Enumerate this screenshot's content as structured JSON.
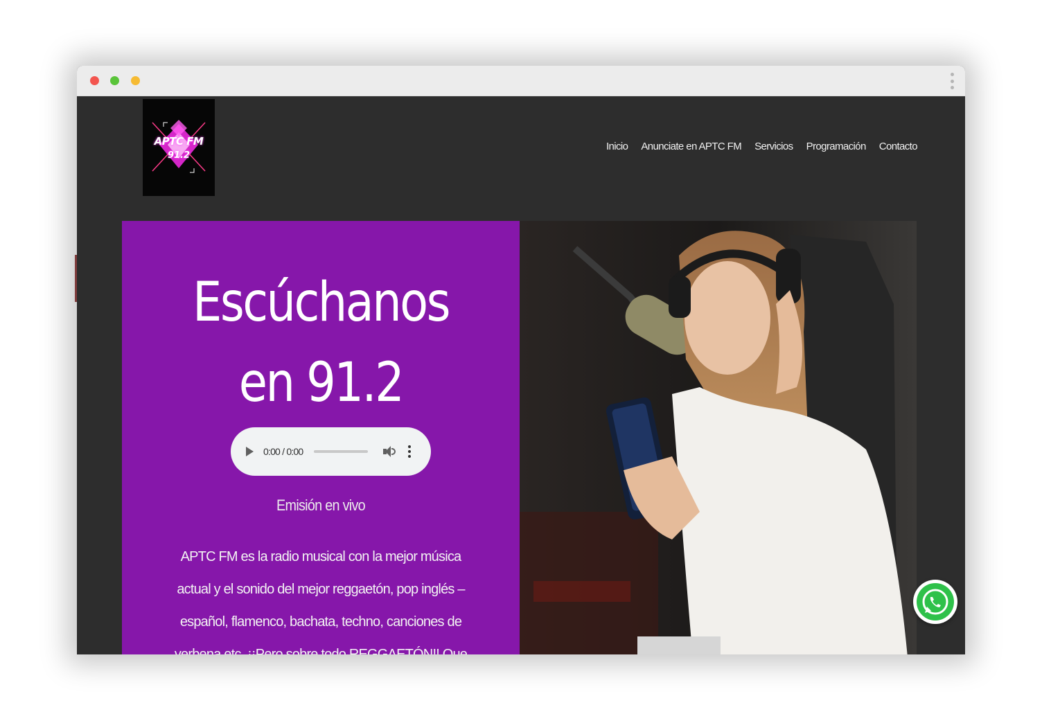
{
  "logo": {
    "line1": "APTC FM",
    "line2": "91.2"
  },
  "nav": {
    "items": [
      {
        "label": "Inicio"
      },
      {
        "label": "Anunciate en APTC FM"
      },
      {
        "label": "Servicios"
      },
      {
        "label": "Programación"
      },
      {
        "label": "Contacto"
      }
    ]
  },
  "hero": {
    "title_line1": "Escúchanos",
    "title_line2": "en 91.2",
    "player": {
      "time": "0:00 / 0:00"
    },
    "live_label": "Emisión en vivo",
    "description": "APTC FM es la radio musical con la mejor música actual y el sonido del mejor reggaetón, pop inglés – español, flamenco, bachata, techno, canciones de verbena etc. ¡¡Pero sobre todo REGGAETÓN!! Que"
  },
  "colors": {
    "hero_bg": "#8617aa",
    "page_bg": "#2d2d2d",
    "whatsapp": "#2ec14a"
  }
}
